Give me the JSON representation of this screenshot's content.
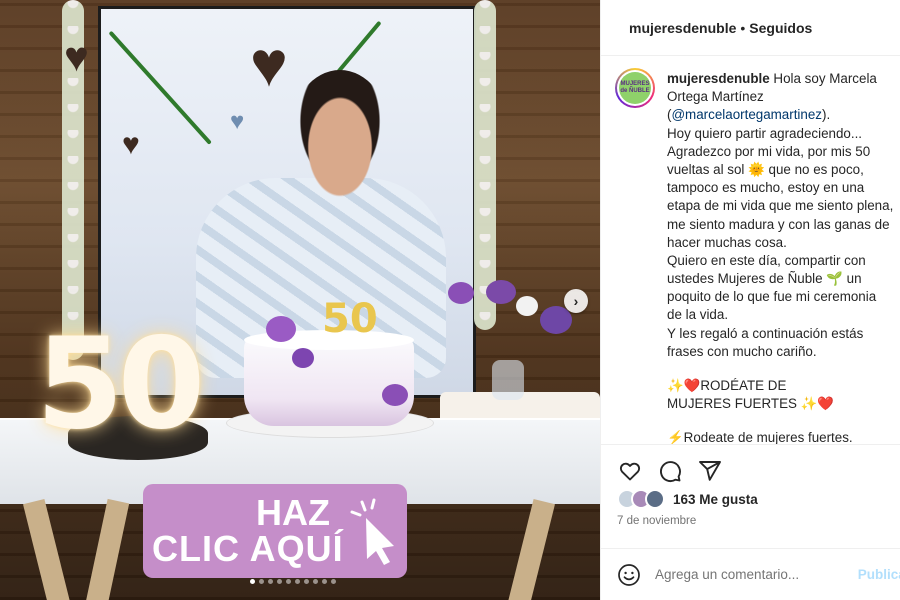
{
  "post": {
    "username": "mujeresdenuble",
    "separator": "•",
    "follow_status": "Seguidos"
  },
  "avatar": {
    "text": "MUJERES de ÑUBLE"
  },
  "media": {
    "overlay_line1": "HAZ",
    "overlay_line2": "CLIC AQUÍ",
    "cake_number": "50",
    "topper_number": "50",
    "next_glyph": "›",
    "carousel_dots": 10,
    "active_dot": 0
  },
  "caption": {
    "lines": [
      {
        "user": "mujeresdenuble",
        "text": " Hola soy Marcela"
      },
      {
        "text": "Ortega Martínez"
      },
      {
        "text": "(",
        "mention": "@marcelaortegamartinez",
        "after": ")."
      },
      {
        "text": "Hoy quiero partir agradeciendo..."
      },
      {
        "text": "Agradezco por mi vida, por mis 50"
      },
      {
        "text": "vueltas al sol 🌞 que no es poco,"
      },
      {
        "text": "tampoco es mucho, estoy en una"
      },
      {
        "text": "etapa de mi vida que me siento plena,"
      },
      {
        "text": "me siento madura y con las ganas de"
      },
      {
        "text": "hacer muchas cosa."
      },
      {
        "text": "Quiero en este día, compartir con"
      },
      {
        "text": "ustedes Mujeres de Ñuble 🌱 un"
      },
      {
        "text": "poquito de lo que fue mi ceremonia"
      },
      {
        "text": "de la vida."
      },
      {
        "text": "Y les regaló a continuación estás"
      },
      {
        "text": "frases con mucho cariño."
      },
      {
        "gap": true
      },
      {
        "text": "✨❤️RODÉATE DE"
      },
      {
        "text": "MUJERES FUERTES ✨❤️"
      },
      {
        "gap": true
      },
      {
        "text": "⚡Rodeate de mujeres fuertes."
      }
    ]
  },
  "engagement": {
    "likes_label": "163 Me gusta",
    "date": "7 de noviembre"
  },
  "comment": {
    "placeholder": "Agrega un comentario...",
    "publish_label": "Publicar"
  },
  "colors": {
    "accent_link": "#00376b",
    "publish_disabled": "#b2dffc",
    "overlay_badge": "#c58ec9",
    "heart": "#262626"
  }
}
